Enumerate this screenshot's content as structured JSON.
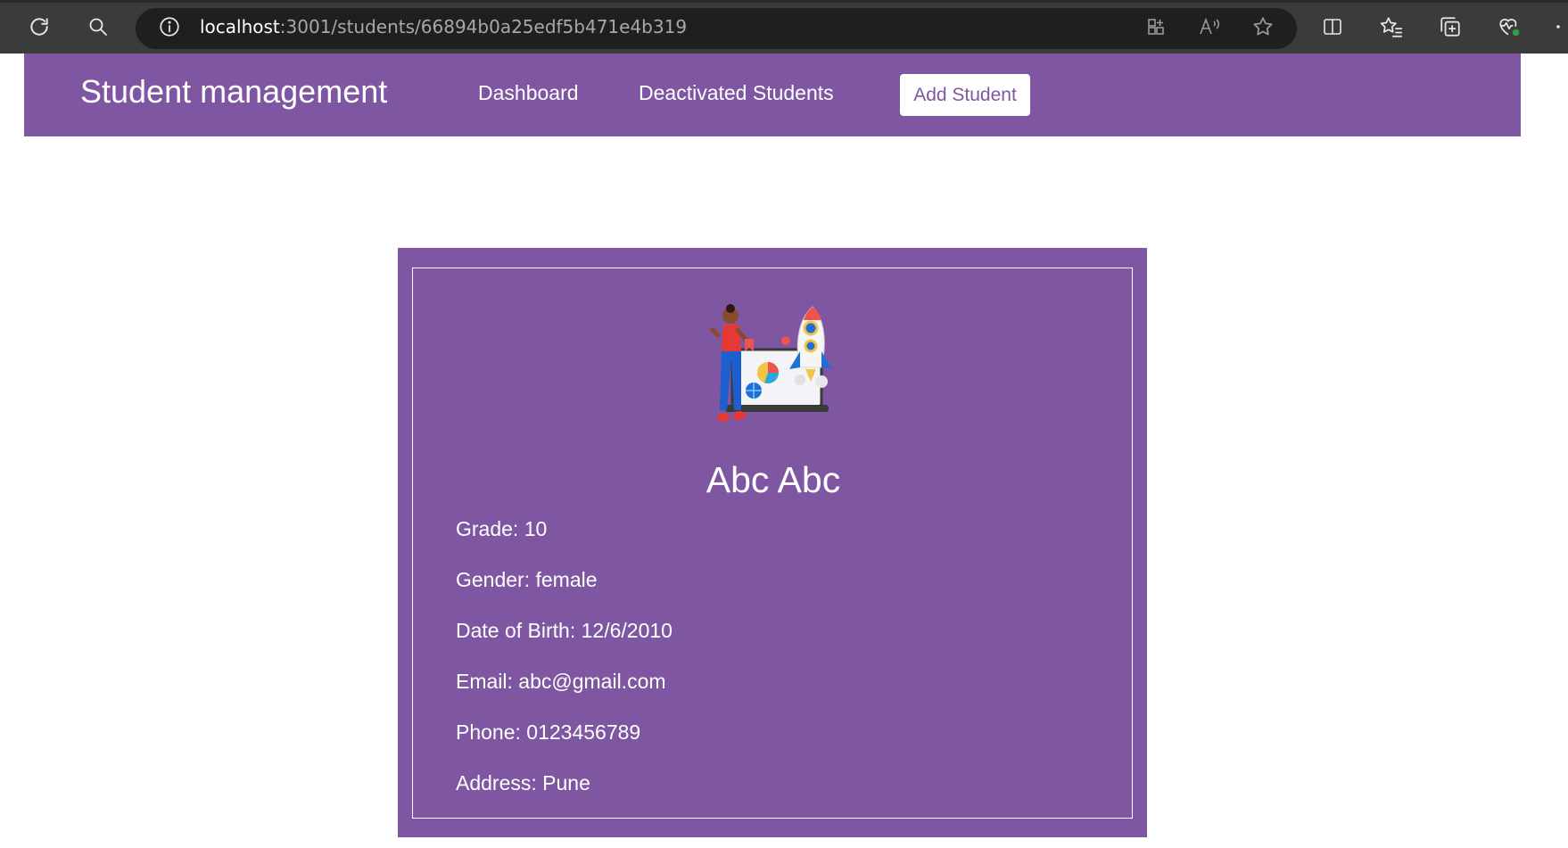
{
  "browser": {
    "url_host": "localhost",
    "url_path": ":3001/students/66894b0a25edf5b471e4b319"
  },
  "navbar": {
    "brand": "Student management",
    "links": [
      {
        "label": "Dashboard"
      },
      {
        "label": "Deactivated Students"
      }
    ],
    "add_button": "Add Student"
  },
  "student": {
    "name": "Abc Abc",
    "grade": "Grade: 10",
    "gender": "Gender: female",
    "dob": "Date of Birth: 12/6/2010",
    "email": "Email: abc@gmail.com",
    "phone": "Phone: 0123456789",
    "address": "Address: Pune"
  },
  "colors": {
    "accent": "#7f56a2",
    "chrome": "#3b3b3b",
    "address_bar": "#1f1f1f"
  },
  "icons": [
    "reload-icon",
    "search-icon",
    "info-icon",
    "apps-icon",
    "read-aloud-icon",
    "favorite-star-icon",
    "split-screen-icon",
    "favorites-icon",
    "collections-icon",
    "browser-essentials-icon",
    "more-icon"
  ]
}
